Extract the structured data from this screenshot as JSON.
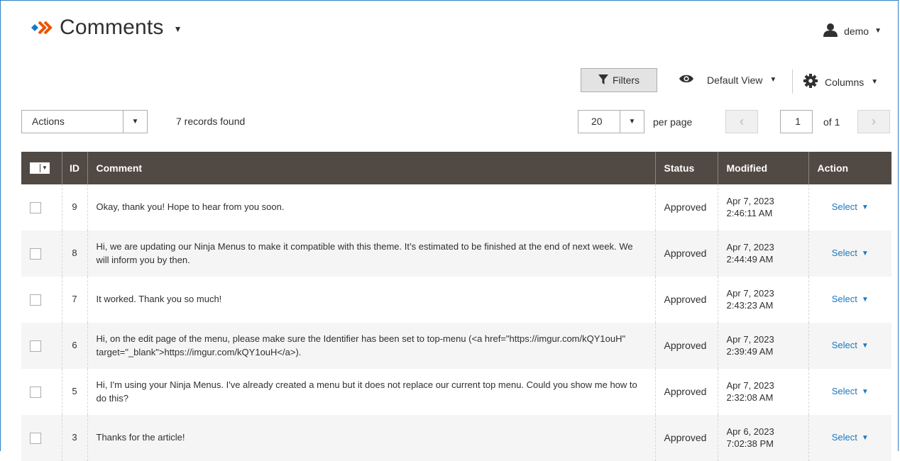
{
  "header": {
    "title": "Comments",
    "user": "demo"
  },
  "toolbar": {
    "filters_label": "Filters",
    "view_label": "Default View",
    "columns_label": "Columns",
    "actions_label": "Actions",
    "records_found": "7 records found",
    "per_page_value": "20",
    "per_page_label": "per page",
    "current_page": "1",
    "page_total": "of 1"
  },
  "icons": {
    "filter": "filter-icon",
    "eye": "eye-icon",
    "gear": "gear-icon",
    "user": "user-icon",
    "prev": "chevron-left-icon",
    "next": "chevron-right-icon"
  },
  "colors": {
    "header_bg": "#514943",
    "link": "#1979c3",
    "logo_blue": "#1979c3",
    "logo_orange": "#eb5202",
    "frame": "#2f7fc1"
  },
  "table": {
    "columns": [
      "ID",
      "Comment",
      "Status",
      "Modified",
      "Action"
    ],
    "rows": [
      {
        "id": "9",
        "comment": "Okay, thank you! Hope to hear from you soon.",
        "status": "Approved",
        "date": "Apr 7, 2023",
        "time": "2:46:11 AM",
        "action": "Select"
      },
      {
        "id": "8",
        "comment": "Hi, we are updating our Ninja Menus to make it compatible with this theme. It’s estimated to be finished at the end of next week. We will inform you by then.",
        "status": "Approved",
        "date": "Apr 7, 2023",
        "time": "2:44:49 AM",
        "action": "Select"
      },
      {
        "id": "7",
        "comment": "It worked. Thank you so much!",
        "status": "Approved",
        "date": "Apr 7, 2023",
        "time": "2:43:23 AM",
        "action": "Select"
      },
      {
        "id": "6",
        "comment": "Hi, on the edit page of the menu, please make sure the Identifier has been set to top-menu (<a href=\"https://imgur.com/kQY1ouH\" target=\"_blank\">https://imgur.com/kQY1ouH</a>).",
        "status": "Approved",
        "date": "Apr 7, 2023",
        "time": "2:39:49 AM",
        "action": "Select"
      },
      {
        "id": "5",
        "comment": "Hi, I'm using your Ninja Menus. I've already created a menu but it does not replace our current top menu. Could you show me how to do this?",
        "status": "Approved",
        "date": "Apr 7, 2023",
        "time": "2:32:08 AM",
        "action": "Select"
      },
      {
        "id": "3",
        "comment": "Thanks for the article!",
        "status": "Approved",
        "date": "Apr 6, 2023",
        "time": "7:02:38 PM",
        "action": "Select"
      }
    ]
  }
}
